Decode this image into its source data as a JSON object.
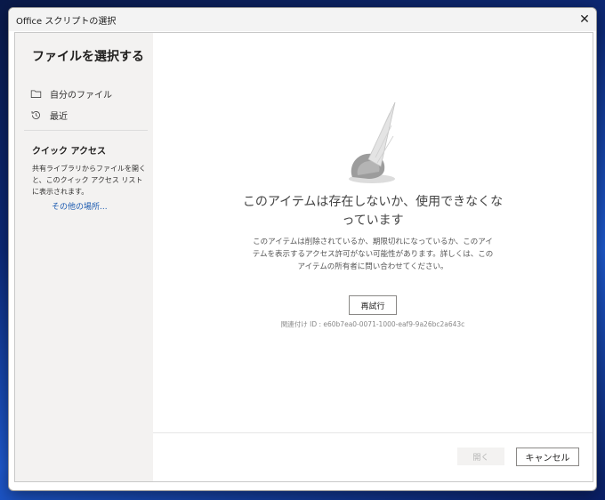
{
  "window": {
    "title": "Office スクリプトの選択"
  },
  "sidebar": {
    "title": "ファイルを選択する",
    "items": [
      {
        "label": "自分のファイル",
        "icon": "folder-icon"
      },
      {
        "label": "最近",
        "icon": "history-icon"
      }
    ],
    "quick_access": {
      "title": "クイック アクセス",
      "description": "共有ライブラリからファイルを開くと、このクイック アクセス リストに表示されます。",
      "link": "その他の場所..."
    }
  },
  "main": {
    "error_title": "このアイテムは存在しないか、使用できなくなっています",
    "error_body": "このアイテムは削除されているか、期限切れになっているか、このアイテムを表示するアクセス許可がない可能性があります。詳しくは、このアイテムの所有者に問い合わせてください。",
    "retry_label": "再試行",
    "correlation_id": "関連付け ID : e60b7ea0-0071-1000-eaf9-9a26bc2a643c"
  },
  "footer": {
    "open_label": "開く",
    "cancel_label": "キャンセル"
  },
  "colors": {
    "link": "#1b5ab0",
    "sidebar_bg": "#f3f2f1"
  }
}
